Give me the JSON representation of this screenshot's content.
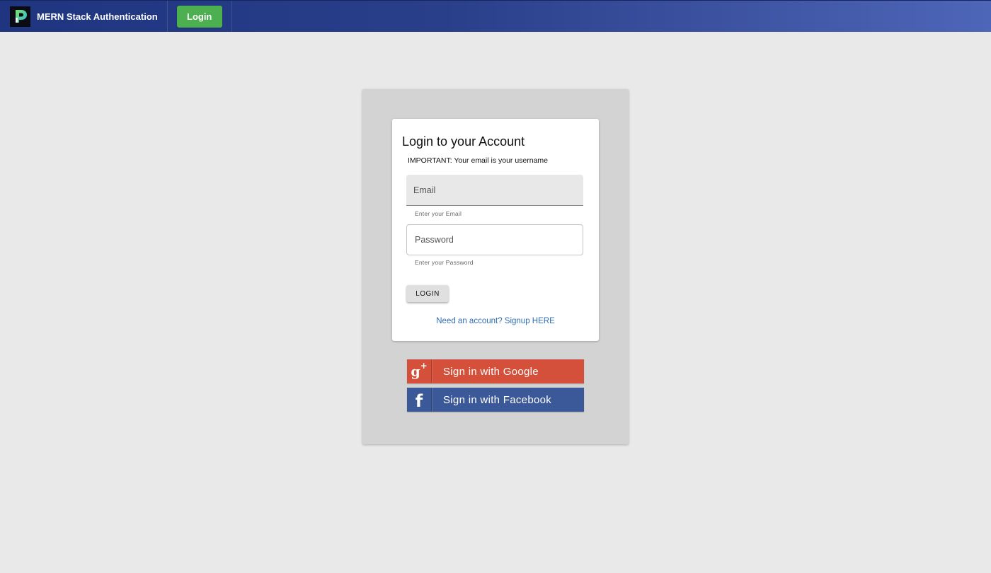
{
  "navbar": {
    "brand_title": "MERN Stack Authentication",
    "login_label": "Login",
    "gradient_start": "#1f3580",
    "gradient_end": "#4e66b8"
  },
  "login_card": {
    "title": "Login to your Account",
    "note": "IMPORTANT: Your email is your username",
    "email": {
      "placeholder": "Email",
      "value": "",
      "helper": "Enter your Email"
    },
    "password": {
      "placeholder": "Password",
      "value": "",
      "helper": "Enter your Password"
    },
    "login_button_label": "LOGIN",
    "signup_link": "Need an account? Signup HERE"
  },
  "social": {
    "google": {
      "label": "Sign in with Google",
      "icon": "google-plus-icon",
      "color": "#d4503a"
    },
    "facebook": {
      "label": "Sign in with Facebook",
      "icon": "facebook-icon",
      "color": "#3b5998"
    }
  }
}
